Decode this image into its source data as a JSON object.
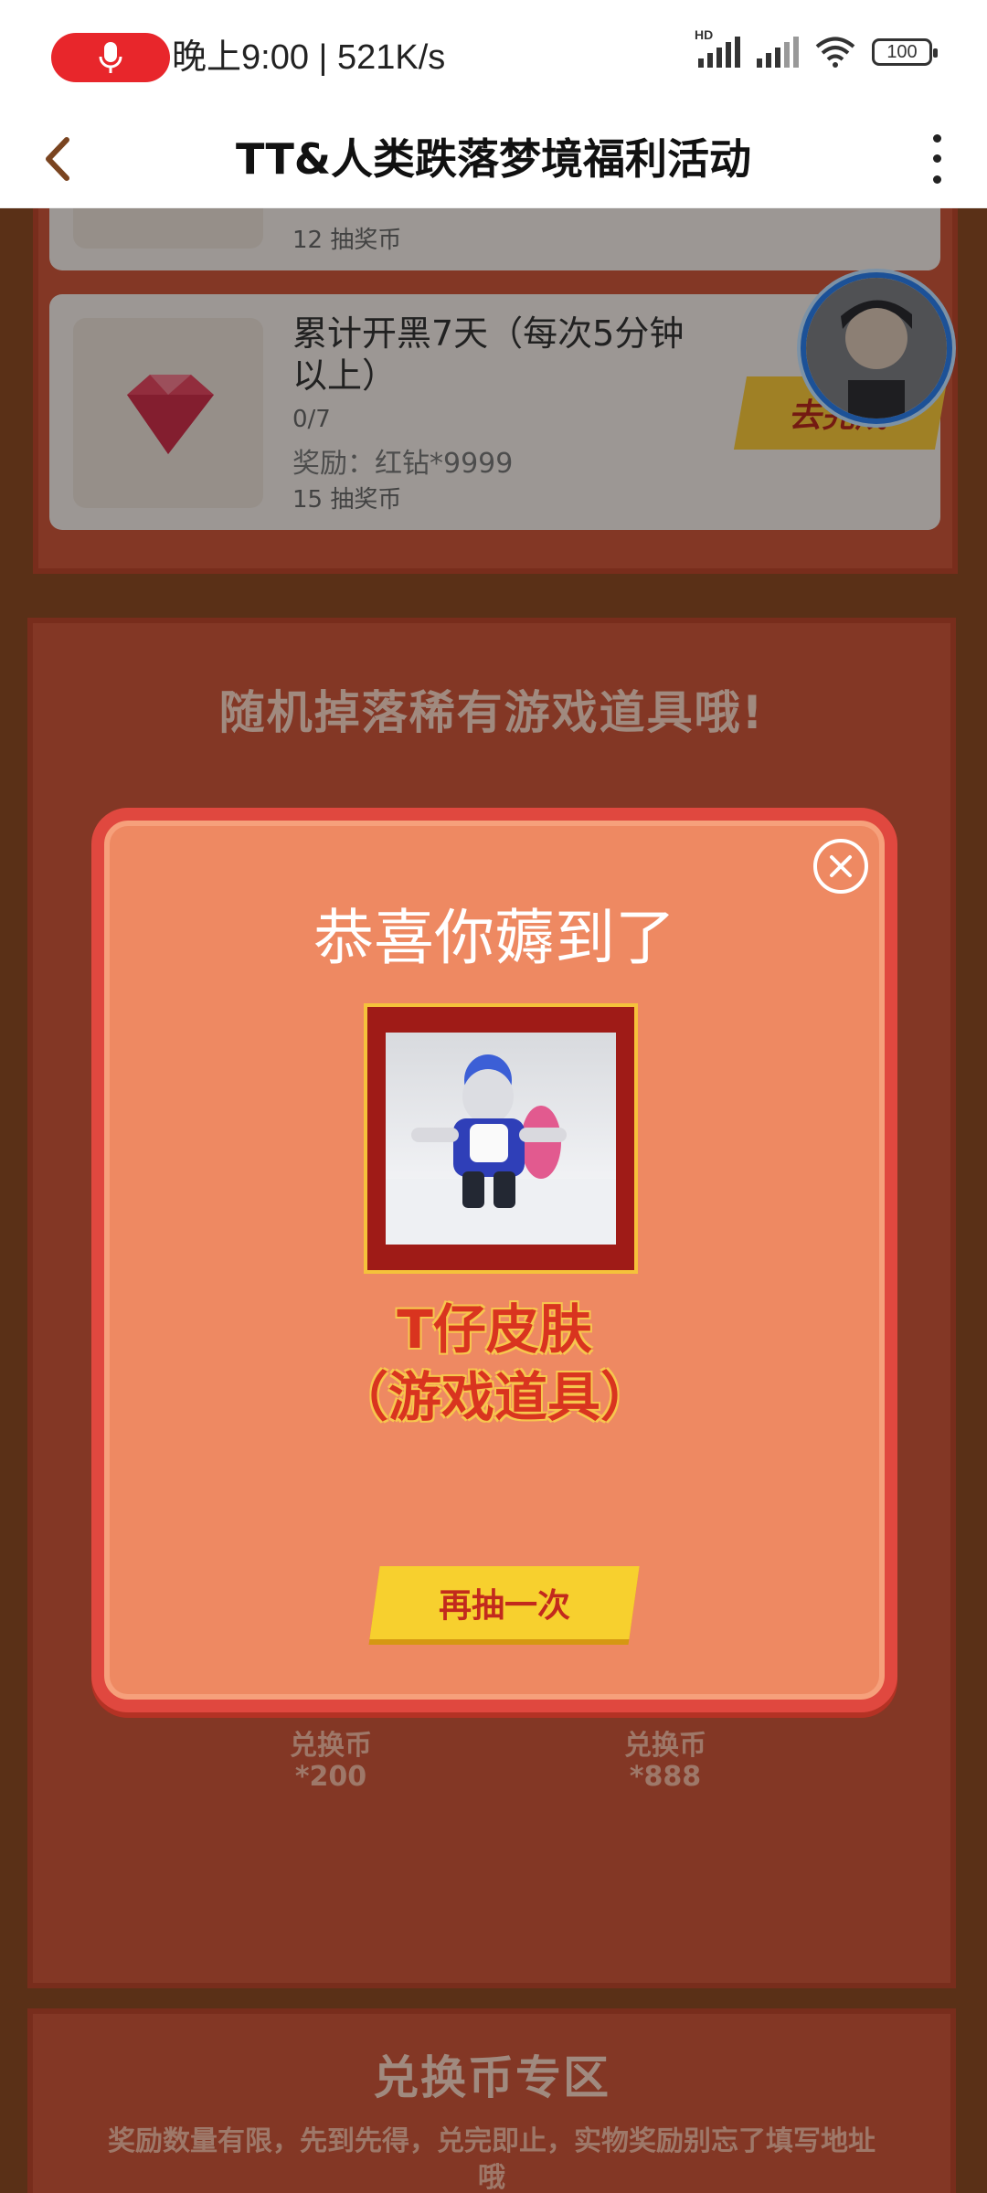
{
  "status_bar": {
    "text": "晚上9:00 | 521K/s",
    "battery": "100",
    "network_badge": "HD"
  },
  "app_bar": {
    "title": "TT&人类跌落梦境福利活动"
  },
  "tasks": {
    "previous_task_coins": "12 抽奖币",
    "task": {
      "title": "累计开黑7天（每次5分钟以上）",
      "progress": "0/7",
      "reward": "奖励：红钻*9999",
      "coins": "15 抽奖币",
      "button": "去完成"
    }
  },
  "section_lottery": {
    "title": "随机掉落稀有游戏道具哦!",
    "items": [
      {
        "label": "兑换币*200"
      },
      {
        "label": "兑换币*888"
      }
    ]
  },
  "section_exchange": {
    "title": "兑换币专区",
    "notice": "奖励数量有限，先到先得，兑完即止，实物奖励别忘了填写地址哦"
  },
  "modal": {
    "title": "恭喜你薅到了",
    "prize_name": "T仔皮肤",
    "prize_type": "（游戏道具）",
    "again_button": "再抽一次"
  },
  "colors": {
    "accent_red": "#e0483f",
    "modal_bg": "#ee8962",
    "button_yellow": "#f7d02e",
    "avatar_ring": "#2c7de8"
  }
}
